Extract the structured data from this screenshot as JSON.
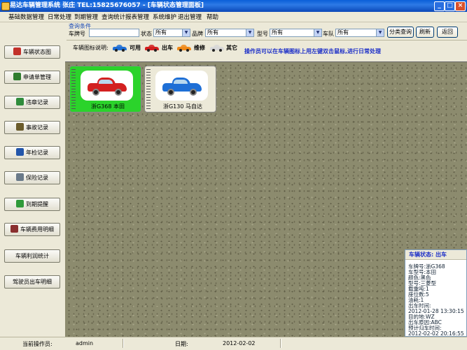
{
  "window": {
    "title": "易达车辆管理系统 张庄 TEL:15825676057 - [车辆状态管理面板]",
    "buttons": {
      "minimize": "_",
      "maximize": "□",
      "close": "×"
    }
  },
  "menu": [
    "基础数据管理",
    "日常处理",
    "到期管理",
    "查询统计报表管理",
    "系统维护",
    "退出管理",
    "帮助"
  ],
  "query": {
    "legend": "查询条件",
    "plate_label": "车牌号",
    "plate_value": "",
    "status_label": "状态",
    "status_value": "所有",
    "brand_label": "品牌",
    "brand_value": "所有",
    "model_label": "型号",
    "model_value": "所有",
    "team_label": "车队",
    "team_value": "所有",
    "btn_query": "分类查询",
    "btn_refresh": "刷新",
    "btn_back": "返回"
  },
  "legend": {
    "label": "车辆图标说明:",
    "items": [
      {
        "label": "可用",
        "color": "#1e6fd6"
      },
      {
        "label": "出车",
        "color": "#d32020"
      },
      {
        "label": "维修",
        "color": "#f08a1a"
      },
      {
        "label": "其它",
        "color": "#d8d8d8"
      }
    ],
    "note": "操作员可以在车辆图标上用左键双击鼠标,进行日常处理"
  },
  "sidebar": [
    {
      "label": "车辆状态图",
      "icon": "car-icon",
      "color": "#c2312a"
    },
    {
      "label": "申请单管理",
      "icon": "person-icon",
      "color": "#2f7d2f"
    },
    {
      "label": "违章记录",
      "icon": "document-icon",
      "color": "#2f8c3c"
    },
    {
      "label": "事故记录",
      "icon": "crash-icon",
      "color": "#6b5c2c"
    },
    {
      "label": "年检记录",
      "icon": "arrow-icon",
      "color": "#2255aa"
    },
    {
      "label": "保险记录",
      "icon": "hand-icon",
      "color": "#6a7a8a"
    },
    {
      "label": "到期提醒",
      "icon": "recycle-icon",
      "color": "#2f9a3a"
    },
    {
      "label": "车辆费用明细",
      "icon": "ledger-icon",
      "color": "#8a2f2f"
    },
    {
      "label": "车辆利润统计",
      "icon": "",
      "color": ""
    },
    {
      "label": "驾驶员出车明细",
      "icon": "",
      "color": ""
    }
  ],
  "vehicles": [
    {
      "plate": "浙G368",
      "name": "本田",
      "status_color": "#2bd32b",
      "car_color": "#d32020"
    },
    {
      "plate": "浙G130",
      "name": "马自达",
      "status_color": "#ece9d8",
      "car_color": "#1e6fd6"
    }
  ],
  "info": {
    "header": "车辆状态: 出车",
    "lines": [
      "车牌号:浙G368",
      "车型号:本田",
      "颜色:黑色",
      "型号:三菱型",
      "载重吨:1",
      "座位数:5",
      "油耗:1",
      "出车时间:",
      "2012-01-28 13:30:15",
      "目的地:WZ",
      "出车原因:ABC",
      "预计归车时间:",
      "2012-02-02 20:16:55"
    ]
  },
  "status": {
    "operator_label": "当前操作员:",
    "operator": "admin",
    "date_label": "日期:",
    "date": "2012-02-02"
  }
}
